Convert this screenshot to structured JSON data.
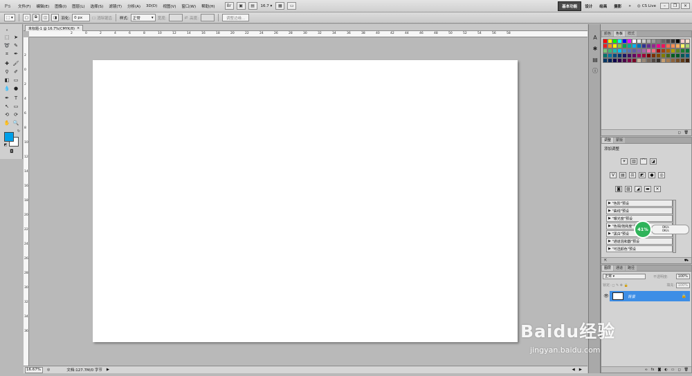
{
  "menubar": {
    "logo": "Ps",
    "items": [
      "文件(F)",
      "编辑(E)",
      "图像(I)",
      "图层(L)",
      "选择(S)",
      "滤镜(T)",
      "分析(A)",
      "3D(D)",
      "视图(V)",
      "窗口(W)",
      "帮助(H)"
    ],
    "zoom": "16.7",
    "workspaces": [
      "基本功能",
      "设计",
      "绘画",
      "摄影"
    ],
    "more": "»",
    "cs_live": "CS Live"
  },
  "optbar": {
    "feather_label": "羽化:",
    "feather_value": "0 px",
    "antialias_label": "消除锯齿",
    "style_label": "样式:",
    "style_value": "正常",
    "width_label": "宽度:",
    "height_label": "高度:",
    "refine_edge": "调整边缘..."
  },
  "document": {
    "tab_title": "未标题-1 @ 16.7%(CMYK/8)",
    "ruler_h_ticks": [
      "2",
      "0",
      "2",
      "4",
      "6",
      "8",
      "10",
      "12",
      "14",
      "16",
      "18",
      "20",
      "22",
      "24",
      "26",
      "28",
      "30",
      "32",
      "34",
      "36",
      "38",
      "40",
      "42",
      "44",
      "46",
      "48",
      "50",
      "52",
      "54",
      "56",
      "58"
    ],
    "ruler_v_ticks": [
      "2",
      "0",
      "2",
      "4",
      "6",
      "8",
      "10",
      "12",
      "14",
      "16",
      "18",
      "20",
      "22",
      "24",
      "26",
      "28",
      "30",
      "32",
      "34",
      "36"
    ],
    "status_zoom": "16.67%",
    "status_doc": "文档:127.7M/0 字节"
  },
  "swatches_panel": {
    "tabs": [
      "颜色",
      "色板",
      "样式"
    ],
    "colors": [
      "#ff0000",
      "#ffff00",
      "#00ff00",
      "#00ffff",
      "#0000ff",
      "#ff00ff",
      "#ffffff",
      "#e6e6e6",
      "#cccccc",
      "#b3b3b3",
      "#999999",
      "#808080",
      "#666666",
      "#4d4d4d",
      "#333333",
      "#000000",
      "#ffcccc",
      "#ffe0cc",
      "#ed1c24",
      "#f7941d",
      "#fff200",
      "#8dc63f",
      "#00a651",
      "#00a99d",
      "#00aeef",
      "#0072bc",
      "#2e3192",
      "#662d91",
      "#92278f",
      "#ec008c",
      "#ed145b",
      "#f26c4f",
      "#f68e56",
      "#fbaf5d",
      "#fff568",
      "#acd373",
      "#7cc576",
      "#3cb878",
      "#1cbbb4",
      "#00bff3",
      "#448ccb",
      "#5674b9",
      "#605ca8",
      "#8560a8",
      "#a864a8",
      "#f06eaa",
      "#f26d7d",
      "#9e0b0f",
      "#a0410d",
      "#a36209",
      "#aba000",
      "#598527",
      "#197b30",
      "#007236",
      "#00746b",
      "#0076a3",
      "#004a80",
      "#003471",
      "#1b1464",
      "#440e62",
      "#630460",
      "#9e005d",
      "#9e0039",
      "#790000",
      "#7b2e00",
      "#7d4900",
      "#827b00",
      "#406618",
      "#005e20",
      "#005826",
      "#005952",
      "#005b7f",
      "#003663",
      "#002157",
      "#0d004c",
      "#32004b",
      "#4b0049",
      "#7b0046",
      "#7a0026",
      "#c7b299",
      "#998675",
      "#736357",
      "#534741",
      "#37302a",
      "#c69c6d",
      "#a67c52",
      "#8c6239",
      "#754c24",
      "#603913",
      "#42210b"
    ]
  },
  "adjust_panel": {
    "tabs": [
      "调整",
      "蒙版"
    ],
    "title": "添加调整",
    "presets": [
      "\"色阶\"预设",
      "\"曲线\"预设",
      "\"曝光度\"预设",
      "\"色相/饱和度\"预设",
      "\"黑白\"预设",
      "\"通道混和器\"预设",
      "\"可选颜色\"预设"
    ],
    "speed_percent": "41%",
    "speed_up": "0K/s",
    "speed_down": "0K/s"
  },
  "layers_panel": {
    "tabs": [
      "图层",
      "通道",
      "路径"
    ],
    "blend_mode": "正常",
    "opacity_label": "不透明度:",
    "opacity_value": "100%",
    "lock_label": "锁定:",
    "fill_label": "填充:",
    "fill_value": "100%",
    "layer_name": "背景"
  },
  "watermark": {
    "brand": "Baidu经验",
    "url": "jingyan.baidu.com"
  }
}
